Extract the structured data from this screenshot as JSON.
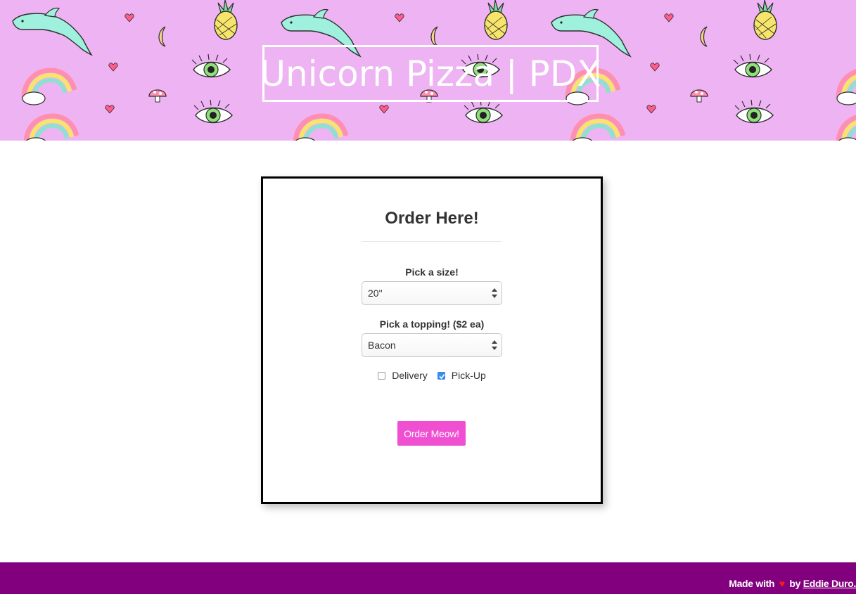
{
  "header": {
    "title": "Unicorn Pizza | PDX"
  },
  "order_form": {
    "heading": "Order Here!",
    "size_label": "Pick a size!",
    "size_value": "20\"",
    "topping_label": "Pick a topping! ($2 ea)",
    "topping_value": "Bacon",
    "delivery_label": "Delivery",
    "delivery_checked": false,
    "pickup_label": "Pick-Up",
    "pickup_checked": true,
    "submit_label": "Order Meow!"
  },
  "footer": {
    "made_with": "Made with",
    "heart": "♥",
    "by": "by",
    "author_link": "Eddie Duro."
  },
  "colors": {
    "banner_bg": "#eeb3f3",
    "button_bg": "#f04fd2",
    "footer_bg": "#82007e",
    "heart": "#ff1a1a",
    "checkbox": "#3b8ef0"
  }
}
